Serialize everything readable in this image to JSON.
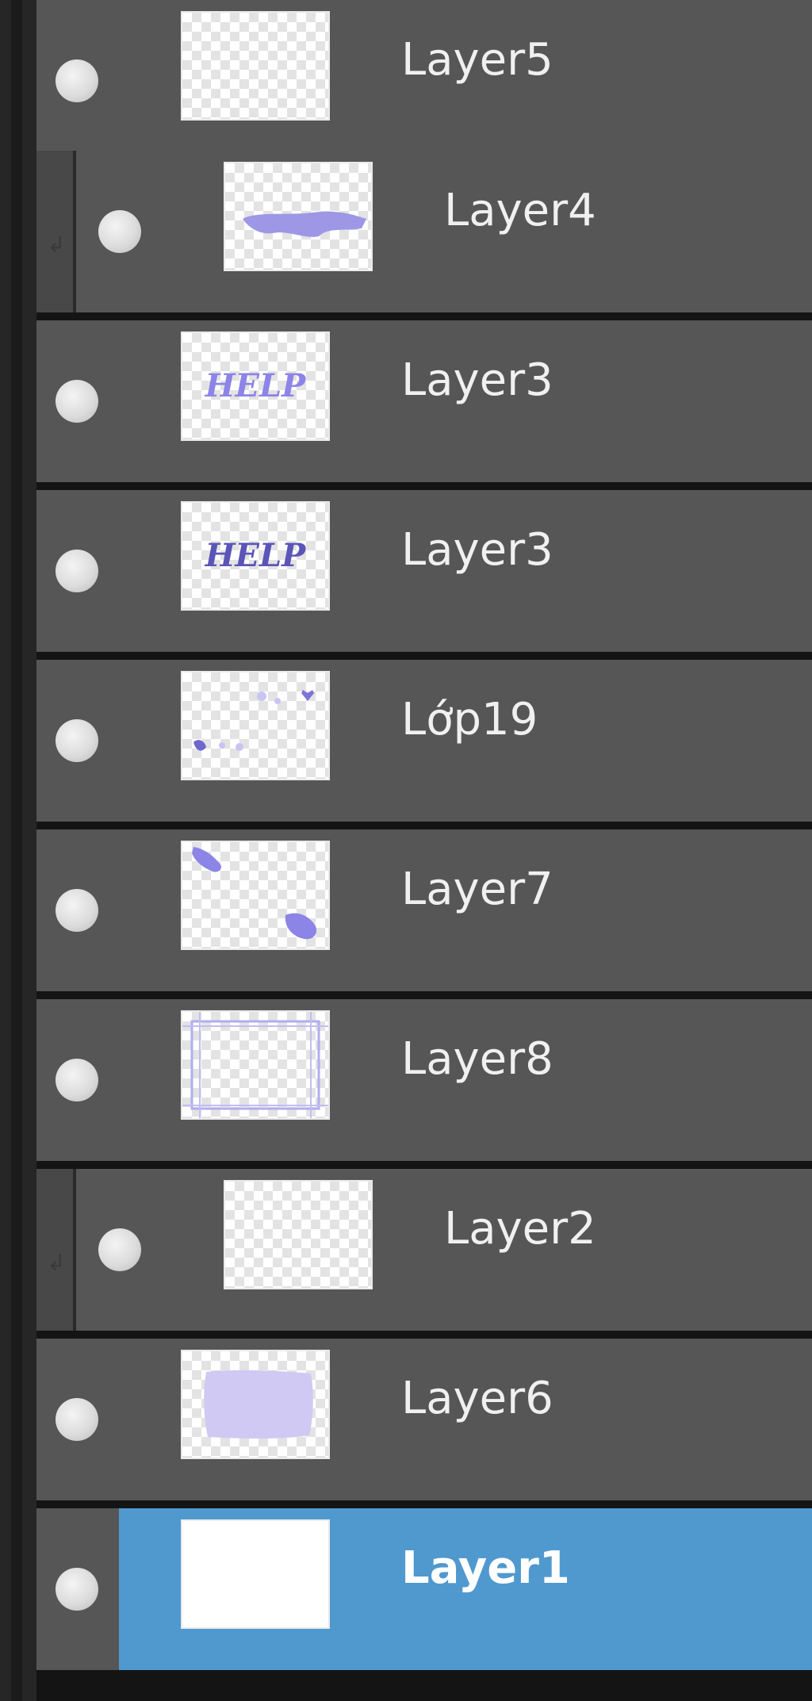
{
  "layers_panel": {
    "layers": [
      {
        "name": "Layer5",
        "clipped": false,
        "selected": false,
        "thumb": "empty"
      },
      {
        "name": "Layer4",
        "clipped": true,
        "selected": false,
        "thumb": "purple-smear"
      },
      {
        "name": "Layer3",
        "clipped": false,
        "selected": false,
        "thumb": "help-light"
      },
      {
        "name": "Layer3",
        "clipped": false,
        "selected": false,
        "thumb": "help-dark"
      },
      {
        "name": "Lớp19",
        "clipped": false,
        "selected": false,
        "thumb": "scatter"
      },
      {
        "name": "Layer7",
        "clipped": false,
        "selected": false,
        "thumb": "corners"
      },
      {
        "name": "Layer8",
        "clipped": false,
        "selected": false,
        "thumb": "frame"
      },
      {
        "name": "Layer2",
        "clipped": true,
        "selected": false,
        "thumb": "empty"
      },
      {
        "name": "Layer6",
        "clipped": false,
        "selected": false,
        "thumb": "lavender-fill"
      },
      {
        "name": "Layer1",
        "clipped": false,
        "selected": true,
        "thumb": "white"
      }
    ]
  },
  "thumb_art": {
    "help_text": "HELP"
  },
  "colors": {
    "row_bg": "#565656",
    "selected_bg": "#5099cf",
    "accent_purple": "#8c84e6",
    "accent_dark_purple": "#5b55b8",
    "lavender": "#cfc9f4"
  },
  "icons": {
    "visibility": "eye-toggle-icon",
    "clip": "clip-arrow-icon"
  }
}
